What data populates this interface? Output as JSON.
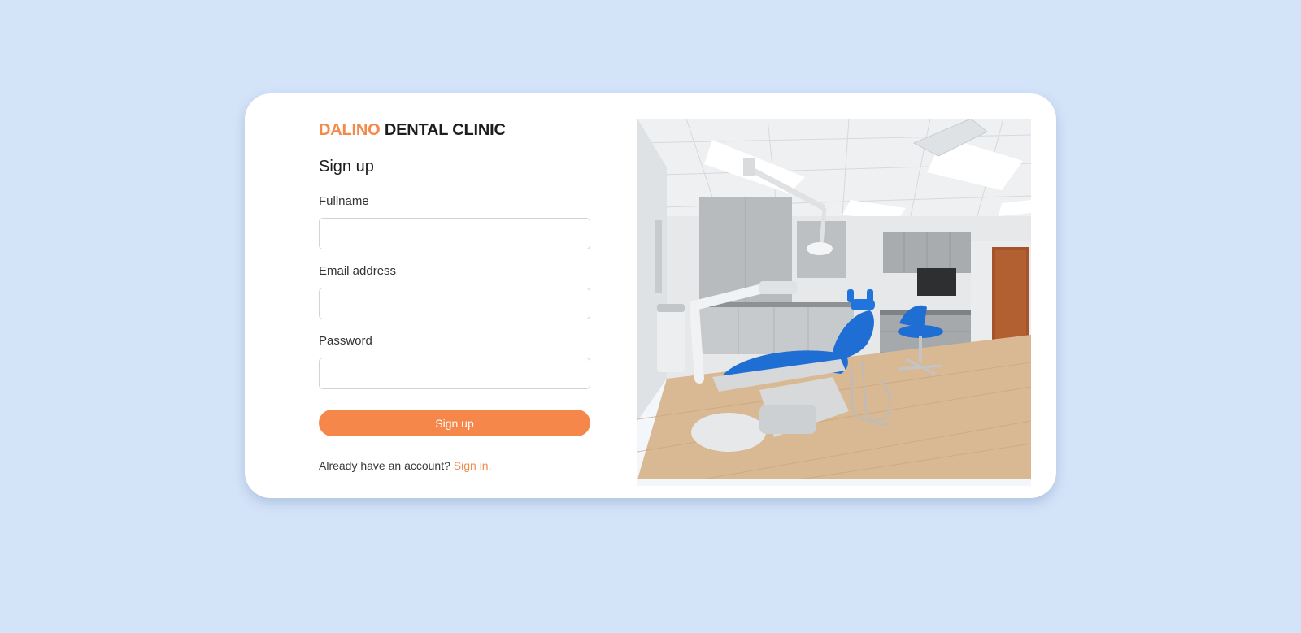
{
  "brand": {
    "accent_text": "DALINO",
    "rest_text": "DENTAL CLINIC"
  },
  "form": {
    "heading": "Sign up",
    "fields": [
      {
        "label": "Fullname",
        "value": "",
        "placeholder": ""
      },
      {
        "label": "Email address",
        "value": "",
        "placeholder": ""
      },
      {
        "label": "Password",
        "value": "",
        "placeholder": ""
      }
    ],
    "submit_label": "Sign up",
    "footer_text": "Already have an account?",
    "footer_link": "Sign in."
  },
  "colors": {
    "page_background": "#d3e3f8",
    "accent": "#f5874a",
    "chair_blue": "#1f6ed4"
  },
  "image": {
    "icon": "dental-clinic-room-photo"
  }
}
